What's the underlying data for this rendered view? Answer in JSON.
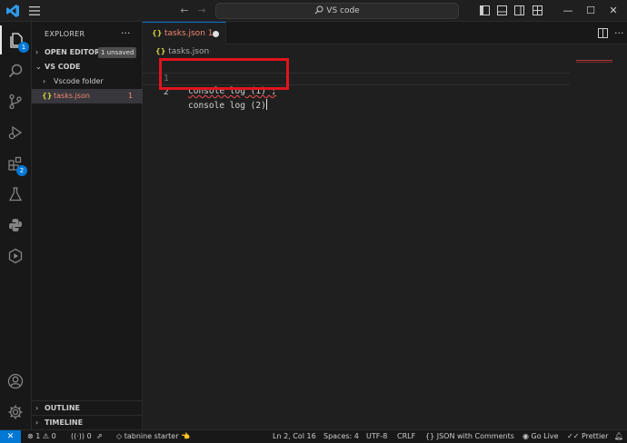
{
  "titlebar": {
    "search_text": "VS code",
    "nav_back": "←",
    "nav_forward": "→",
    "minimize": "—",
    "maximize": "☐",
    "close": "✕"
  },
  "activity": {
    "explorer_badge": "1",
    "extensions_badge": "2"
  },
  "sidebar": {
    "title": "EXPLORER",
    "more": "···",
    "open_editors_label": "OPEN EDITORS",
    "unsaved_badge": "1 unsaved",
    "workspace_label": "VS CODE",
    "folder_label": "Vscode folder",
    "file_label": "tasks.json",
    "file_problems": "1",
    "outline_label": "OUTLINE",
    "timeline_label": "TIMELINE"
  },
  "editor": {
    "tab_label": "tasks.json 1",
    "breadcrumb": "tasks.json",
    "lines": [
      {
        "num": "1",
        "text": "console log (1) ;"
      },
      {
        "num": "2",
        "text": "console log (2)"
      }
    ]
  },
  "status": {
    "errors": "1",
    "warnings": "0",
    "ports": "0",
    "tabnine": "tabnine starter",
    "position": "Ln 2, Col 16",
    "spaces": "Spaces: 4",
    "encoding": "UTF-8",
    "eol": "CRLF",
    "language": "JSON with Comments",
    "golive": "Go Live",
    "prettier": "Prettier"
  },
  "colors": {
    "accent": "#0078d4",
    "highlight_box": "#e0141c",
    "error_text": "#f48771"
  }
}
